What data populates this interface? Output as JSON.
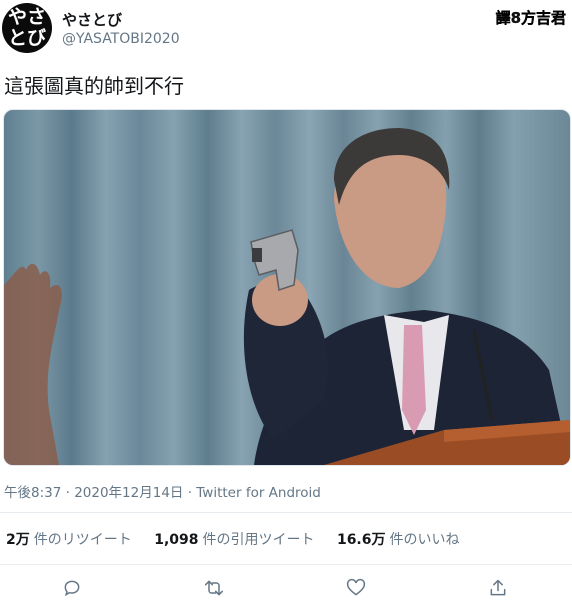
{
  "author": {
    "avatar_text_line1": "やさ",
    "avatar_text_line2": "とび",
    "display_name": "やさとび",
    "handle": "@YASATOBI2020"
  },
  "translator_badge": "譯8方吉君",
  "tweet": {
    "text": "這張圖真的帥到不行",
    "timestamp": "午後8:37 · 2020年12月14日 · Twitter for Android"
  },
  "stats": {
    "retweets_count": "2万",
    "retweets_label": "件のリツイート",
    "quotes_count": "1,098",
    "quotes_label": "件の引用ツイート",
    "likes_count": "16.6万",
    "likes_label": "件のいいね"
  },
  "actions": [
    {
      "icon": "reply-icon"
    },
    {
      "icon": "retweet-icon"
    },
    {
      "icon": "like-icon"
    },
    {
      "icon": "share-icon"
    }
  ],
  "colors": {
    "secondary_text": "#657786",
    "primary_text": "#14171a",
    "divider": "#e6ecf0"
  }
}
